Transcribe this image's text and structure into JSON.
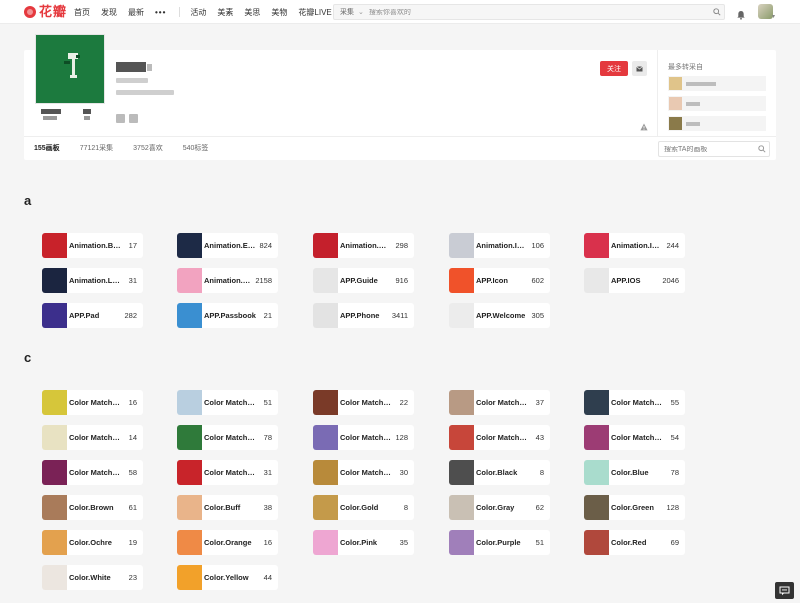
{
  "logo_text": "花瓣",
  "nav": {
    "primary": [
      "首页",
      "发现",
      "最新"
    ],
    "more": "•••",
    "secondary": [
      "活动",
      "美素",
      "美思",
      "美物",
      "花瓣LIVE"
    ]
  },
  "search": {
    "category": "采集",
    "placeholder": "搜索你喜欢的"
  },
  "profile": {
    "follow_label": "关注",
    "recent_title": "最多转采自",
    "tabs": [
      "155画板",
      "77121采集",
      "3752喜欢",
      "540标签"
    ],
    "board_search_placeholder": "搜索TA的画板"
  },
  "colors": {
    "accent": "#e4393e",
    "avatar_bg": "#1c7a3e"
  },
  "sections": [
    {
      "letter": "a",
      "boards": [
        {
          "name": "Animation.Brand",
          "count": "17",
          "color": "#c8222a"
        },
        {
          "name": "Animation.Emoji",
          "count": "824",
          "color": "#1d2a46"
        },
        {
          "name": "Animation.Gallery",
          "count": "298",
          "color": "#c4202c"
        },
        {
          "name": "Animation.Icon",
          "count": "106",
          "color": "#c9ccd4"
        },
        {
          "name": "Animation.Interface",
          "count": "244",
          "color": "#d9314c"
        },
        {
          "name": "Animation.Loading",
          "count": "31",
          "color": "#1b2540"
        },
        {
          "name": "Animation.Menu",
          "count": "2158",
          "color": "#f2a3c0"
        },
        {
          "name": "APP.Guide",
          "count": "916",
          "color": "#e6e6e6"
        },
        {
          "name": "APP.Icon",
          "count": "602",
          "color": "#f0522a"
        },
        {
          "name": "APP.IOS",
          "count": "2046",
          "color": "#e8e8e8"
        },
        {
          "name": "APP.Pad",
          "count": "282",
          "color": "#3c2f8c"
        },
        {
          "name": "APP.Passbook",
          "count": "21",
          "color": "#3a8fd1"
        },
        {
          "name": "APP.Phone",
          "count": "3411",
          "color": "#e3e3e3"
        },
        {
          "name": "APP.Welcome",
          "count": "305",
          "color": "#ececec"
        }
      ]
    },
    {
      "letter": "c",
      "boards": [
        {
          "name": "Color Matching",
          "count": "16",
          "color": "#d6c63a"
        },
        {
          "name": "Color Matching",
          "count": "51",
          "color": "#b9cfe0"
        },
        {
          "name": "Color Matching",
          "count": "22",
          "color": "#7a3a28"
        },
        {
          "name": "Color Matching",
          "count": "37",
          "color": "#b89a84"
        },
        {
          "name": "Color Matching",
          "count": "55",
          "color": "#2f3e4e"
        },
        {
          "name": "Color Matching",
          "count": "14",
          "color": "#e8e2c2"
        },
        {
          "name": "Color Matching",
          "count": "78",
          "color": "#2f7a3a"
        },
        {
          "name": "Color Matching",
          "count": "128",
          "color": "#7a6bb4"
        },
        {
          "name": "Color Matching",
          "count": "43",
          "color": "#c7463a"
        },
        {
          "name": "Color Matching",
          "count": "54",
          "color": "#9c3c74"
        },
        {
          "name": "Color Matching",
          "count": "58",
          "color": "#7a2256"
        },
        {
          "name": "Color Matching",
          "count": "31",
          "color": "#c8242a"
        },
        {
          "name": "Color Matching",
          "count": "30",
          "color": "#b88a3a"
        },
        {
          "name": "Color.Black",
          "count": "8",
          "color": "#4e4e4e"
        },
        {
          "name": "Color.Blue",
          "count": "78",
          "color": "#a9dccd"
        },
        {
          "name": "Color.Brown",
          "count": "61",
          "color": "#a97b5a"
        },
        {
          "name": "Color.Buff",
          "count": "38",
          "color": "#e9b48a"
        },
        {
          "name": "Color.Gold",
          "count": "8",
          "color": "#c49a4a"
        },
        {
          "name": "Color.Gray",
          "count": "62",
          "color": "#c9c0b4"
        },
        {
          "name": "Color.Green",
          "count": "128",
          "color": "#6b5e48"
        },
        {
          "name": "Color.Ochre",
          "count": "19",
          "color": "#e3a14e"
        },
        {
          "name": "Color.Orange",
          "count": "16",
          "color": "#ef8a46"
        },
        {
          "name": "Color.Pink",
          "count": "35",
          "color": "#eea6d2"
        },
        {
          "name": "Color.Purple",
          "count": "51",
          "color": "#a07fba"
        },
        {
          "name": "Color.Red",
          "count": "69",
          "color": "#b0483c"
        },
        {
          "name": "Color.White",
          "count": "23",
          "color": "#ece6e0"
        },
        {
          "name": "Color.Yellow",
          "count": "44",
          "color": "#f2a12a"
        }
      ]
    }
  ]
}
